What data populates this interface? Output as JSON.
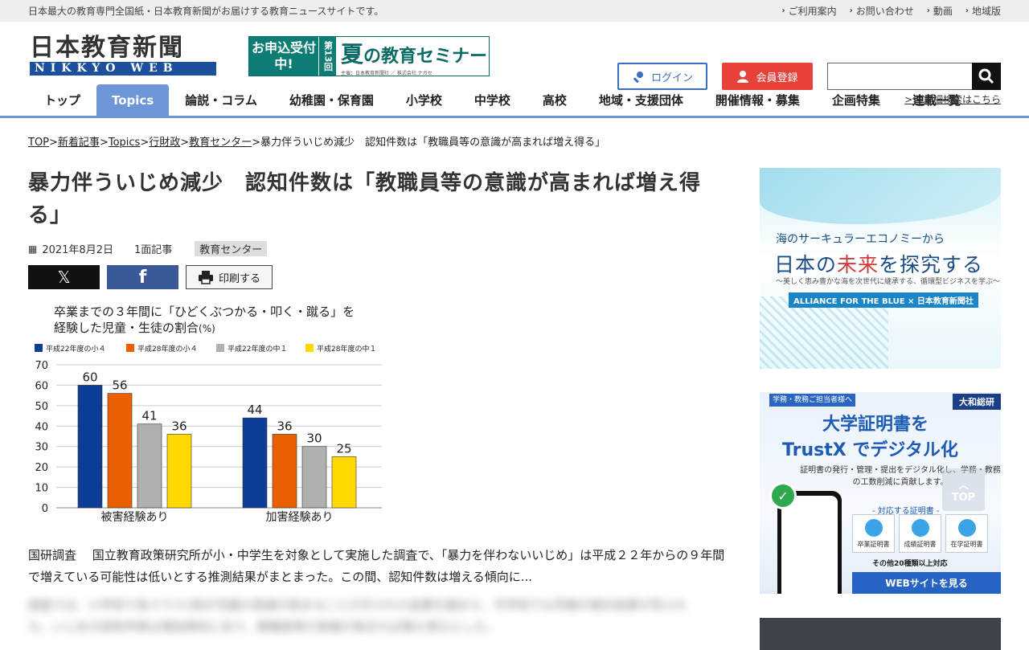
{
  "topbar": {
    "tagline": "日本最大の教育専門全国紙・日本教育新聞がお届けする教育ニュースサイトです。",
    "links": [
      "ご利用案内",
      "お問い合わせ",
      "動画",
      "地域版"
    ]
  },
  "header": {
    "logo_main": "日本教育新聞",
    "logo_sub": "NIKKYO WEB",
    "banner": {
      "left": "お申込受付中!",
      "vertical": "第13回",
      "title_big": "夏",
      "title_rest": "の教育セミナー",
      "small": "主催：日本教育新聞社 ／ 株式会社 ナガセ"
    },
    "login_label": "ログイン",
    "register_label": "会員登録",
    "search_placeholder": "",
    "advanced_search": ">> 詳細検索はこちら"
  },
  "nav": {
    "items": [
      "トップ",
      "Topics",
      "論説・コラム",
      "幼稚園・保育園",
      "小学校",
      "中学校",
      "高校",
      "地域・支援団体",
      "開催情報・募集",
      "企画特集",
      "連載一覧"
    ],
    "active": "Topics"
  },
  "breadcrumb": {
    "links": [
      "TOP",
      "新着記事",
      "Topics",
      "行財政",
      "教育センター"
    ],
    "current": "暴力伴ういじめ減少　認知件数は「教職員等の意識が高まれば増え得る」",
    "sep": ">"
  },
  "article": {
    "title": "暴力伴ういじめ減少　認知件数は「教職員等の意識が高まれば増え得る」",
    "date": "2021年8月2日",
    "page": "1面記事",
    "tag": "教育センター",
    "share_print": "印刷する",
    "lead": "国研調査　 国立教育政策研究所が小・中学生を対象として実施した調査で、「暴力を伴わないいじめ」は平成２２年からの９年間で増えている可能性は低いとする推測結果がまとまった。この間、認知件数は増える傾向に...",
    "blurred": "調査では、小学校で各クラス1割が児童の意識が高まることが示された結果を踏まえ、中学校でも同様の推計結果が見られた。いじめの認知件数は増加傾向にあり、教職員等の意識が高まれば増え得るとした。"
  },
  "chart_data": {
    "type": "bar",
    "title_line1": "卒業までの３年間に「ひどくぶつかる・叩く・蹴る」を",
    "title_line2": "経験した児童・生徒の割合",
    "title_unit": "(%)",
    "categories": [
      "被害経験あり",
      "加害経験あり"
    ],
    "series": [
      {
        "name": "平成22年度の小４",
        "values": [
          60,
          44
        ],
        "color": "#0d3d99"
      },
      {
        "name": "平成28年度の小４",
        "values": [
          56,
          36
        ],
        "color": "#ea6000"
      },
      {
        "name": "平成22年度の中１",
        "values": [
          41,
          30
        ],
        "color": "#b0b0b0"
      },
      {
        "name": "平成28年度の中１",
        "values": [
          36,
          25
        ],
        "color": "#ffd800"
      }
    ],
    "ylim": [
      0,
      70
    ],
    "yticks": [
      0,
      10,
      20,
      30,
      40,
      50,
      60,
      70
    ],
    "grid": true,
    "legend": "top"
  },
  "sidebar": {
    "ad1": {
      "line1": "海のサーキュラーエコノミーから",
      "line2a": "日本の",
      "line2b": "未来",
      "line2c": "を探究する",
      "line3": "〜美しく恵み豊かな海を次世代に継承する、循環型ビジネスを学ぶ〜",
      "line4": "ALLIANCE FOR THE BLUE × 日本教育新聞社"
    },
    "ad2": {
      "tag": "学務・教務ご担当者様へ",
      "company": "大和総研",
      "title1": "大学証明書を",
      "title2": "TrustX でデジタル化",
      "desc": "証明書の発行・管理・提出をデジタル化し、学務・教務の工数削減に貢献します。",
      "cert_heading": "- 対応する証明書 -",
      "certs": [
        "卒業証明書",
        "成績証明書",
        "在学証明書"
      ],
      "etc": "その他20種類以上対応",
      "cta": "WEBサイトを見る"
    },
    "totop": "TOP"
  }
}
